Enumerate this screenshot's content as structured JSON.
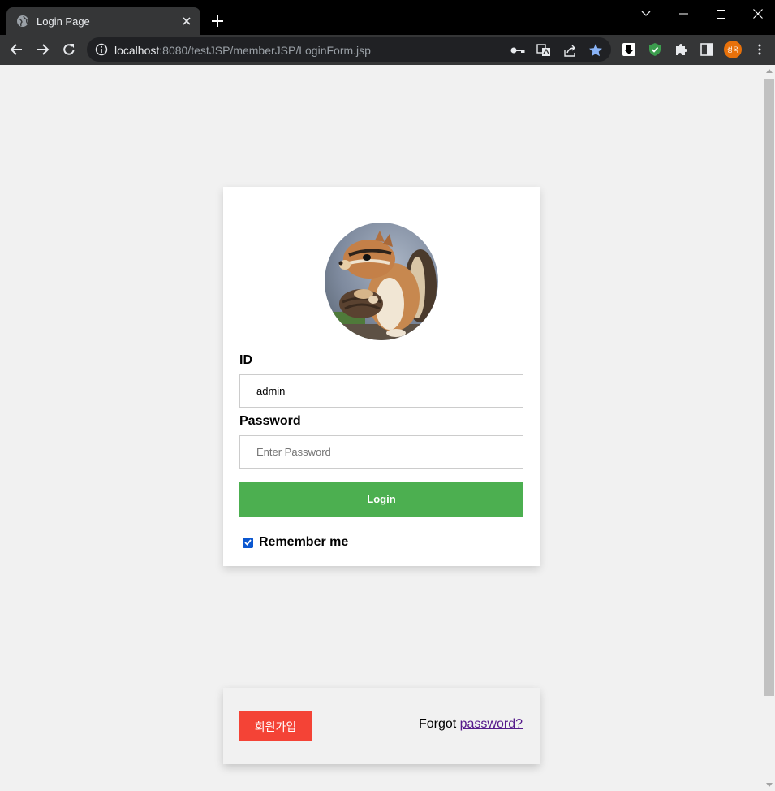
{
  "browser": {
    "tab_title": "Login Page",
    "url_host": "localhost",
    "url_rest": ":8080/testJSP/memberJSP/LoginForm.jsp",
    "profile_initials": "성옥",
    "icons": {
      "favicon": "globe-icon",
      "tab_close": "close-icon",
      "new_tab": "plus-icon",
      "tab_search": "chevron-down-icon",
      "minimize": "minimize-icon",
      "maximize": "maximize-icon",
      "close_window": "close-icon",
      "back": "arrow-left-icon",
      "forward": "arrow-right-icon",
      "reload": "reload-icon",
      "site_info": "info-icon",
      "password_key": "key-icon",
      "translate": "translate-icon",
      "share": "share-icon",
      "bookmark": "star-icon",
      "download_ext": "download-icon",
      "shield_ext": "shield-icon",
      "extensions": "puzzle-icon",
      "side_panel": "side-panel-icon",
      "menu": "kebab-menu-icon"
    }
  },
  "login_form": {
    "id_label": "ID",
    "id_value": "admin",
    "password_label": "Password",
    "password_placeholder": "Enter Password",
    "password_value": "",
    "login_button": "Login",
    "remember_label": "Remember me",
    "remember_checked": true,
    "avatar": "chipmunk-avatar-image"
  },
  "footer": {
    "signup_button": "회원가입",
    "forgot_prefix": "Forgot ",
    "forgot_link": "password?"
  },
  "colors": {
    "login_button": "#4caf50",
    "signup_button": "#f44336",
    "link": "#551a8b",
    "page_background": "#f1f1f1"
  }
}
